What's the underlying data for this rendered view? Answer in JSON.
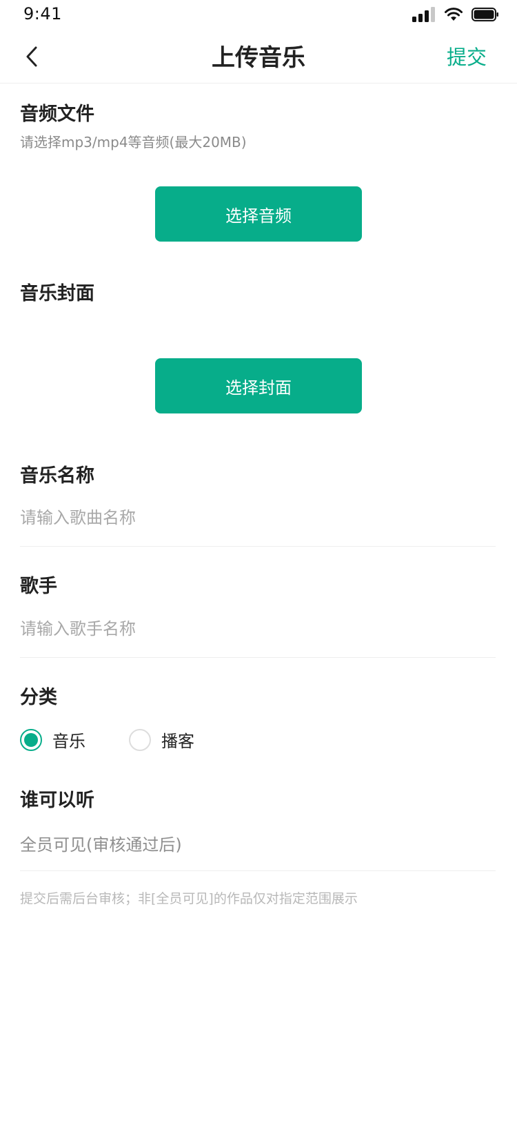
{
  "status_bar": {
    "time": "9:41",
    "icons": [
      "cellular-signal-icon",
      "wifi-icon",
      "battery-icon"
    ]
  },
  "nav": {
    "title": "上传音乐",
    "submit_label": "提交",
    "back_icon": "chevron-left-icon"
  },
  "audio_section": {
    "label": "音频文件",
    "hint": "请选择mp3/mp4等音频(最大20MB)",
    "button_label": "选择音频"
  },
  "cover_section": {
    "label": "音乐封面",
    "button_label": "选择封面"
  },
  "name_section": {
    "label": "音乐名称",
    "placeholder": "请输入歌曲名称"
  },
  "singer_section": {
    "label": "歌手",
    "placeholder": "请输入歌手名称"
  },
  "category_section": {
    "label": "分类",
    "options": [
      {
        "label": "音乐",
        "selected": true
      },
      {
        "label": "播客",
        "selected": false
      }
    ]
  },
  "visibility_section": {
    "label": "谁可以听",
    "value": "全员可见(审核通过后)"
  },
  "footer_note": "提交后需后台审核；非[全员可见]的作品仅对指定范围展示",
  "colors": {
    "accent": "#07ad8a",
    "text": "#222222",
    "hint": "#8a8a8a",
    "divider": "#eeeeee"
  }
}
